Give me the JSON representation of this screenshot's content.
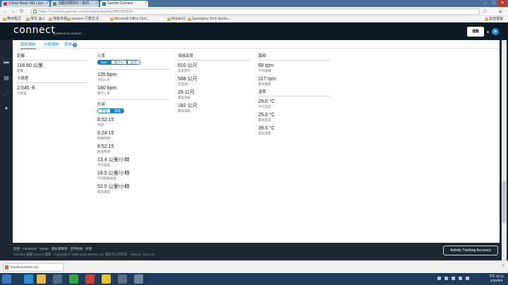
{
  "browser": {
    "tabs": [
      {
        "label": "3 Best Music Mix | Epi...",
        "fav_color": "#d33a2f"
      },
      {
        "label": "活動詳細資料 | 第四...",
        "fav_color": "#3c9a48"
      },
      {
        "label": "Garmin Connect",
        "fav_color": "#1a7fc4"
      }
    ],
    "url": "https://connect.garmin.com/modern/activity/880369696",
    "bookmarks": [
      "應用程式",
      "保安 論人 ...",
      "博客來網...",
      "amazon 行動生活 ...",
      "Microsoft Office Onli...",
      "Mobile01",
      "Speedplay Tech Series..."
    ],
    "other_bookmarks": "其他書籤"
  },
  "header": {
    "logo": "connect",
    "logo_sub": "powered by Garmin",
    "nav_button": "運動",
    "plus": "+"
  },
  "subtabs": [
    {
      "label": "統計資料"
    },
    {
      "label": "分段資料"
    },
    {
      "label": "其他",
      "badge": "2"
    }
  ],
  "stats": {
    "distance": {
      "title": "距離",
      "value": "118.60 公里",
      "label": "距離"
    },
    "calories": {
      "title": "卡路里",
      "value": "2,545 卡",
      "label": "卡路里"
    },
    "heart_rate": {
      "title": "心率",
      "toggle": [
        "bpm",
        "最大%",
        "區間"
      ],
      "items": [
        {
          "value": "135 bpm",
          "label": "平均心率"
        },
        {
          "value": "180 bpm",
          "label": "最大心率"
        }
      ]
    },
    "timing": {
      "title": "計時",
      "toggle": [
        "步速",
        "速度"
      ],
      "items": [
        {
          "value": "8:52:15",
          "label": "時間"
        },
        {
          "value": "6:24:15",
          "label": "移動時間"
        },
        {
          "value": "8:52:15",
          "label": "經過時間"
        },
        {
          "value": "13.4 公里/小時",
          "label": "平均速度"
        },
        {
          "value": "18.5 公里/小時",
          "label": "平均移動速度"
        },
        {
          "value": "52.0 公里/小時",
          "label": "最高速度"
        }
      ]
    },
    "elevation": {
      "title": "海拔高度",
      "items": [
        {
          "value": "610 公尺",
          "label": "高度爬升"
        },
        {
          "value": "588 公尺",
          "label": "高度減少"
        },
        {
          "value": "29 公尺",
          "label": "最低海拔"
        },
        {
          "value": "182 公尺",
          "label": "最高海拔"
        }
      ]
    },
    "cadence": {
      "title": "踏頻",
      "items": [
        {
          "value": "68 rpm",
          "label": "平均踏頻"
        },
        {
          "value": "117 rpm",
          "label": "最高踏頻"
        }
      ]
    },
    "temperature": {
      "title": "溫度",
      "items": [
        {
          "value": "29.0 °C",
          "label": "平均溫度"
        },
        {
          "value": "25.0 °C",
          "label": "最低溫度"
        },
        {
          "value": "39.0 °C",
          "label": "最高溫度"
        }
      ]
    }
  },
  "footer": {
    "links": "說明 · Facebook · Twitter · 隱私權聲明 · 使用條款 · 狀態",
    "copyright": "Connect 隸屬 Garmin 連線 · Copyright © 1996-2015 Garmin Ltd. 或其子公司所有 · Version: 15.9.2.0",
    "activity_tracking_button": "Activity Tracking Accuracy"
  },
  "download": {
    "file": "GarminConnect.csv"
  },
  "clock": {
    "time": "下午 10:11",
    "date": "2015/9/9"
  }
}
